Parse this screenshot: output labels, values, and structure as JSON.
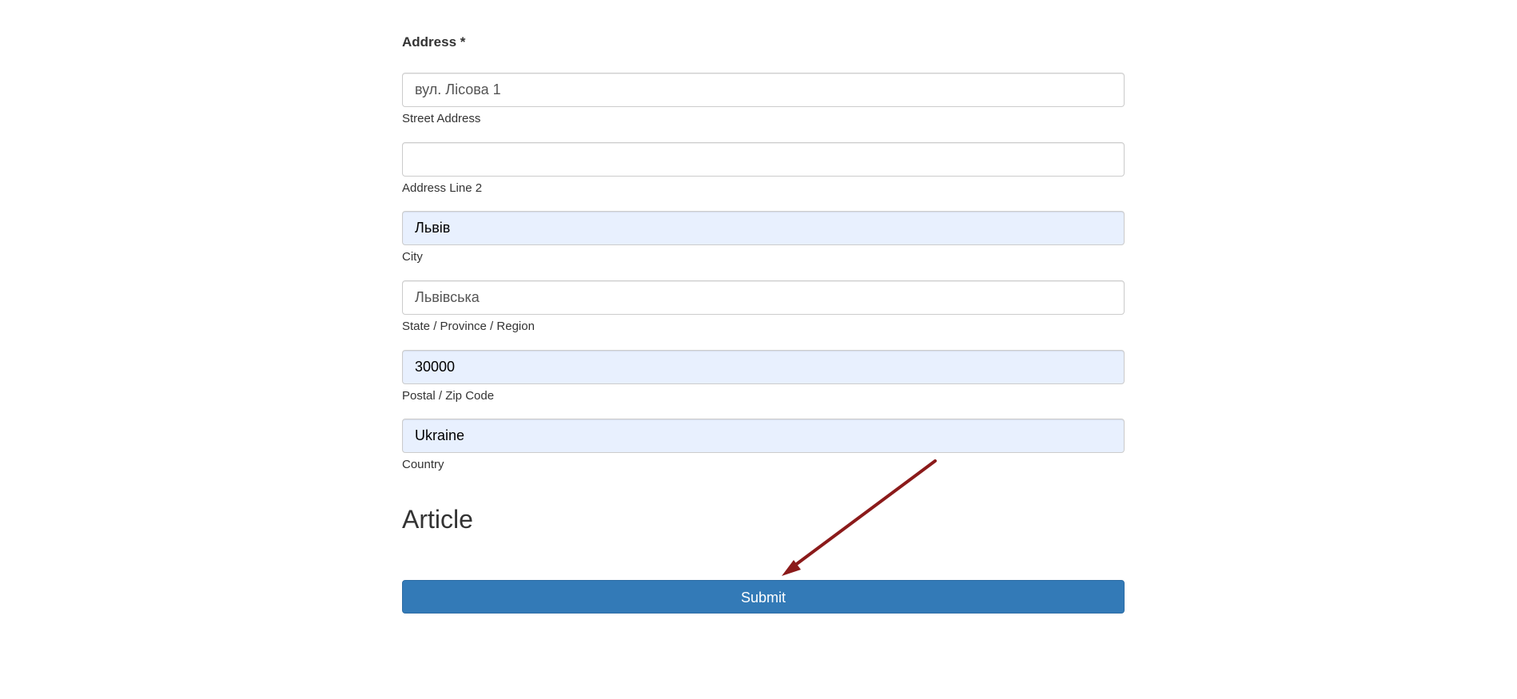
{
  "form": {
    "address_label": "Address *",
    "fields": [
      {
        "value": "вул. Лісова 1",
        "sublabel": "Street Address"
      },
      {
        "value": "",
        "sublabel": "Address Line 2"
      },
      {
        "value": "Львів",
        "sublabel": "City"
      },
      {
        "value": "Львівська",
        "sublabel": "State / Province / Region"
      },
      {
        "value": "30000",
        "sublabel": "Postal / Zip Code"
      },
      {
        "value": "Ukraine",
        "sublabel": "Country"
      }
    ],
    "article_heading": "Article",
    "submit_label": "Submit"
  },
  "colors": {
    "primary_button": "#337ab7",
    "autofill_background": "#e8f0fe",
    "annotation_arrow": "#8b1a1a"
  }
}
